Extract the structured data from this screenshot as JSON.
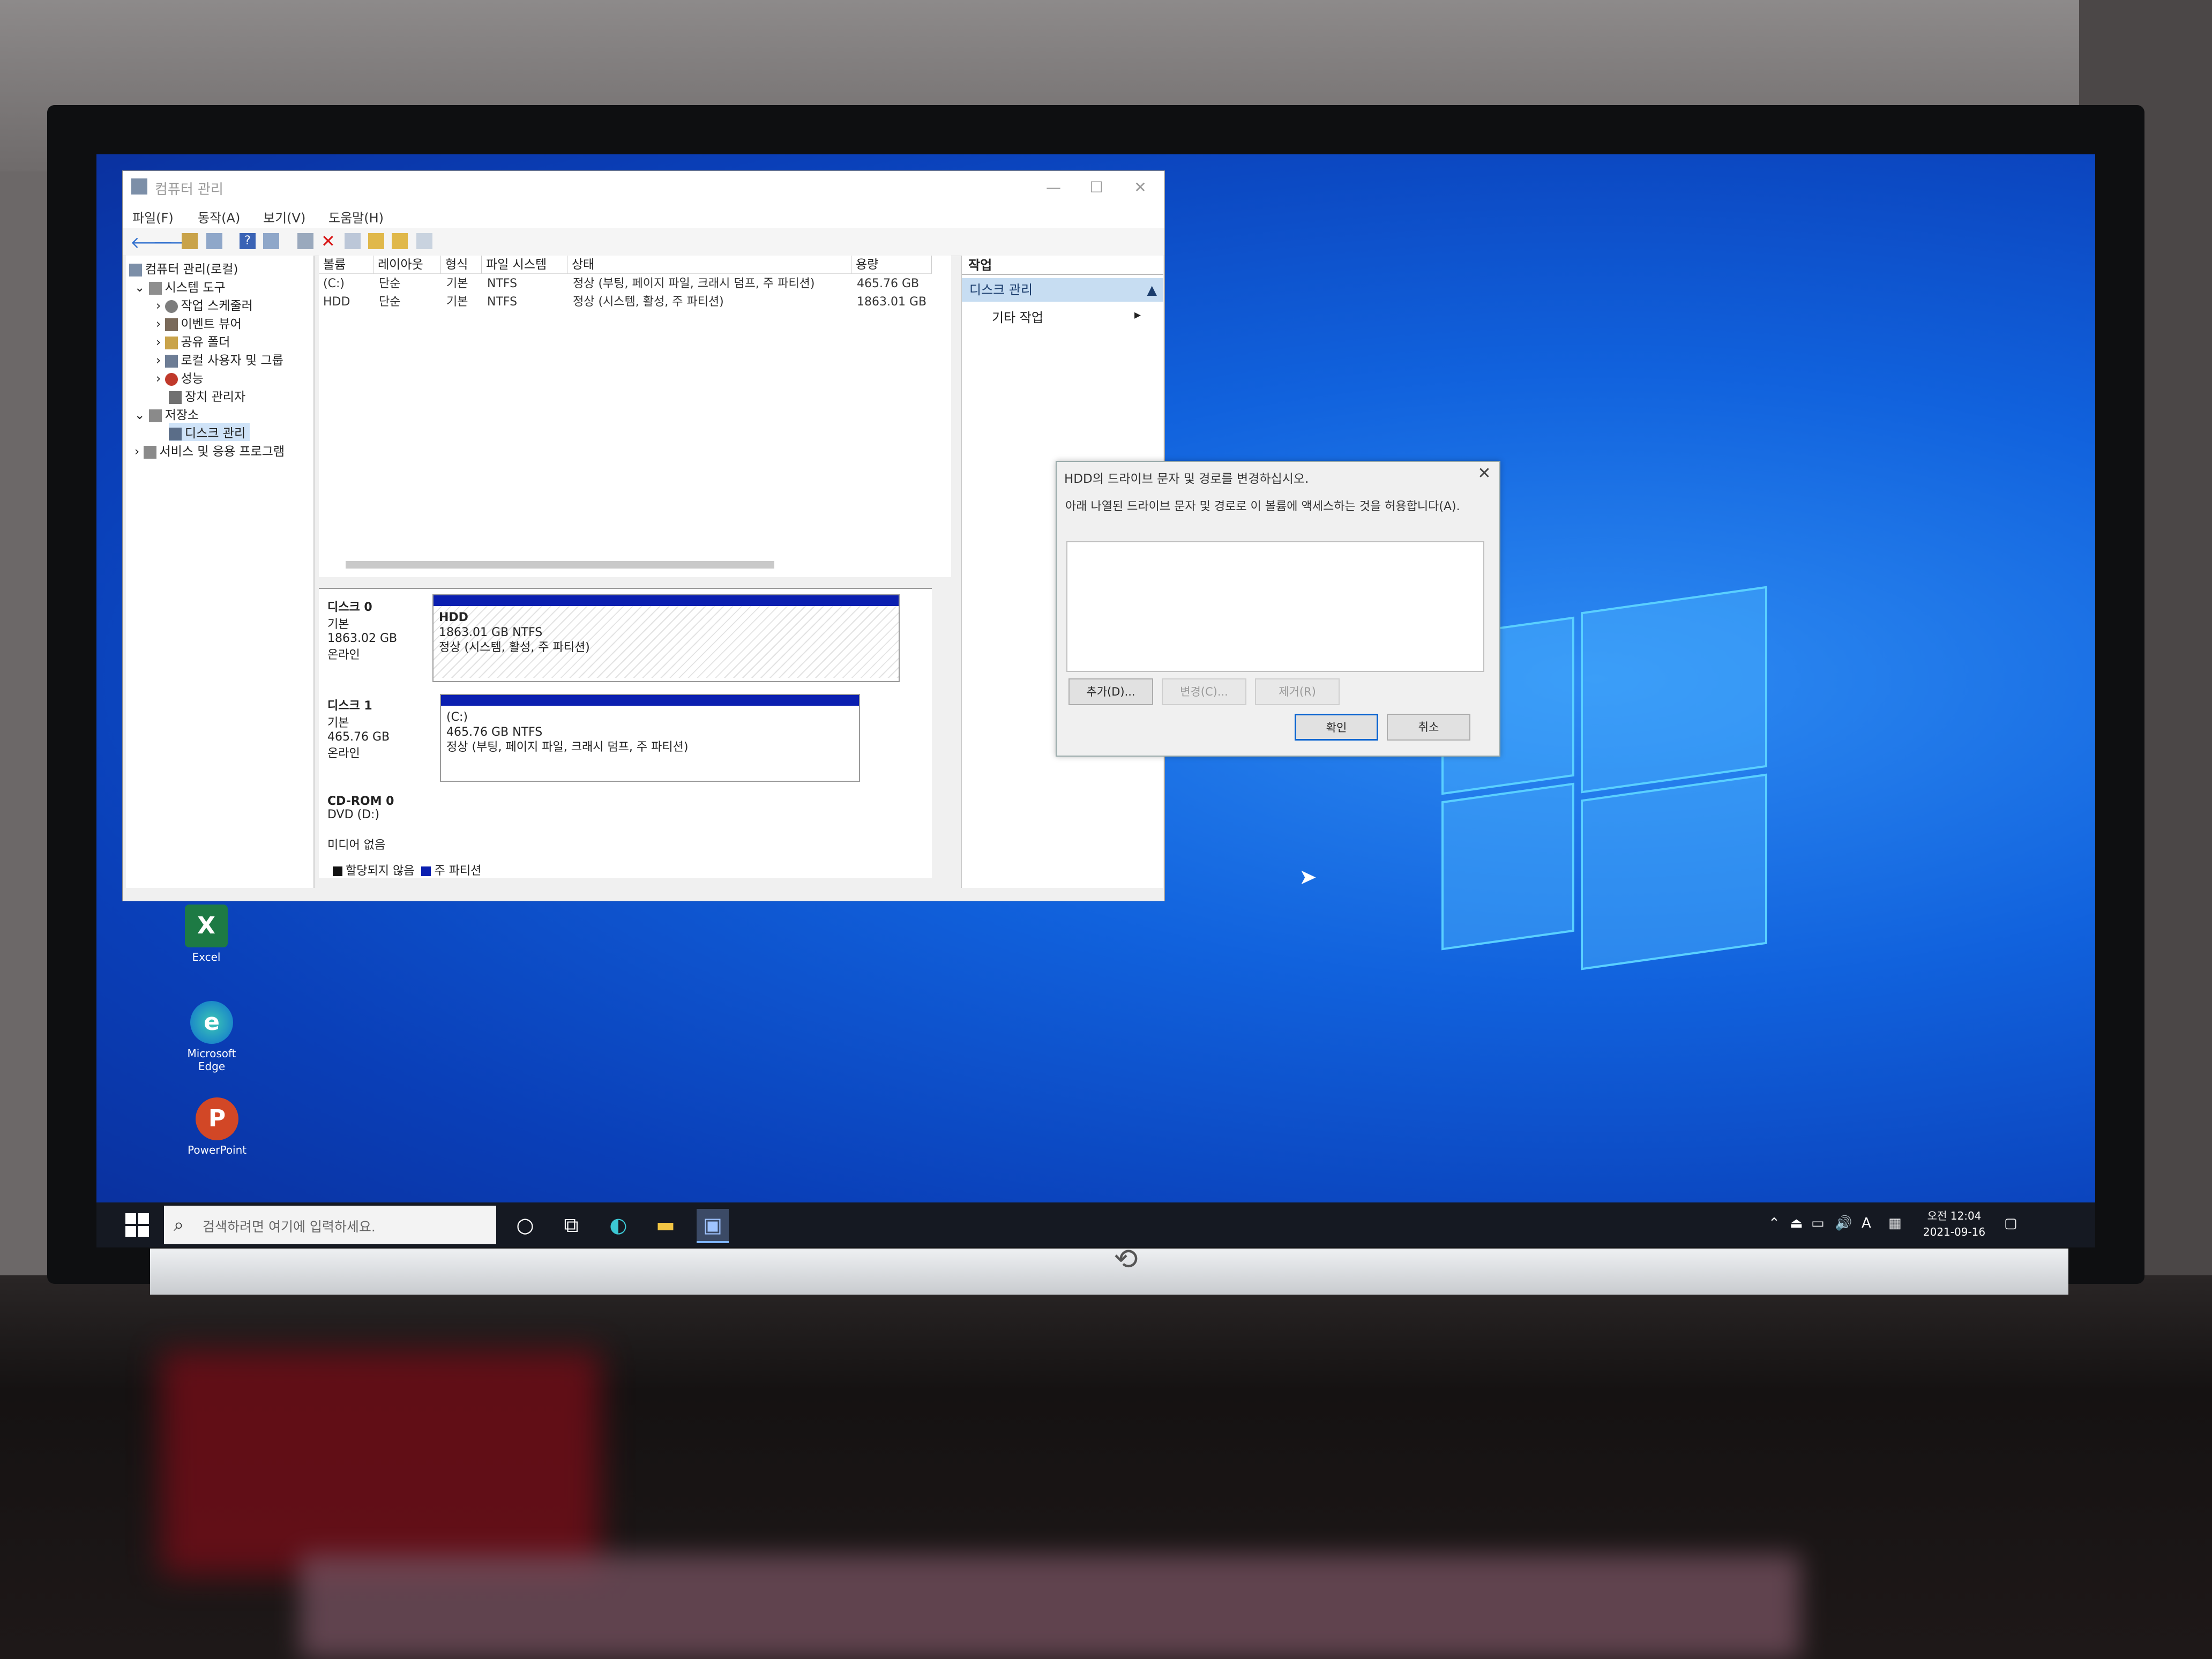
{
  "window": {
    "title": "컴퓨터 관리",
    "menu": [
      "파일(F)",
      "동작(A)",
      "보기(V)",
      "도움말(H)"
    ],
    "tree": [
      {
        "label": "컴퓨터 관리(로컬)"
      },
      {
        "label": "시스템 도구"
      },
      {
        "label": "작업 스케줄러"
      },
      {
        "label": "이벤트 뷰어"
      },
      {
        "label": "공유 폴더"
      },
      {
        "label": "로컬 사용자 및 그룹"
      },
      {
        "label": "성능"
      },
      {
        "label": "장치 관리자"
      },
      {
        "label": "저장소"
      },
      {
        "label": "디스크 관리"
      },
      {
        "label": "서비스 및 응용 프로그램"
      }
    ],
    "columns": [
      "볼륨",
      "레이아웃",
      "형식",
      "파일 시스템",
      "상태",
      "용량"
    ],
    "volumes": [
      {
        "volume": "(C:)",
        "layout": "단순",
        "type": "기본",
        "fs": "NTFS",
        "status": "정상 (부팅, 페이지 파일, 크래시 덤프, 주 파티션)",
        "capacity": "465.76 GB"
      },
      {
        "volume": "HDD",
        "layout": "단순",
        "type": "기본",
        "fs": "NTFS",
        "status": "정상 (시스템, 활성, 주 파티션)",
        "capacity": "1863.01 GB"
      }
    ],
    "disks": [
      {
        "name": "디스크 0",
        "type": "기본",
        "size": "1863.02 GB",
        "state": "온라인",
        "part_name": "HDD",
        "part_size": "1863.01 GB NTFS",
        "part_status": "정상 (시스템, 활성, 주 파티션)"
      },
      {
        "name": "디스크 1",
        "type": "기본",
        "size": "465.76 GB",
        "state": "온라인",
        "part_name": "(C:)",
        "part_size": "465.76 GB NTFS",
        "part_status": "정상 (부팅, 페이지 파일, 크래시 덤프, 주 파티션)"
      },
      {
        "name": "CD-ROM 0",
        "type": "DVD (D:)",
        "size": "",
        "state": "미디어 없음"
      }
    ],
    "legend": {
      "unallocated": "할당되지 않음",
      "primary": "주 파티션"
    },
    "actions": {
      "header": "작업",
      "selected": "디스크 관리",
      "more": "기타 작업"
    }
  },
  "dialog": {
    "title": "HDD의 드라이브 문자 및 경로를 변경하십시오.",
    "label": "아래 나열된 드라이브 문자 및 경로로 이 볼륨에 액세스하는 것을 허용합니다(A).",
    "add": "추가(D)...",
    "change": "변경(C)...",
    "remove": "제거(R)",
    "ok": "확인",
    "cancel": "취소"
  },
  "desktop": {
    "icons": [
      {
        "label": "Excel"
      },
      {
        "label": "Microsoft Edge"
      },
      {
        "label": "PowerPoint"
      }
    ]
  },
  "taskbar": {
    "search_placeholder": "검색하려면 여기에 입력하세요.",
    "tray_lang": "A",
    "time": "오전 12:04",
    "date": "2021-09-16"
  },
  "colors": {
    "accent": "#0b1fb0",
    "desktop": "#1162dd",
    "taskbar": "#151922"
  }
}
